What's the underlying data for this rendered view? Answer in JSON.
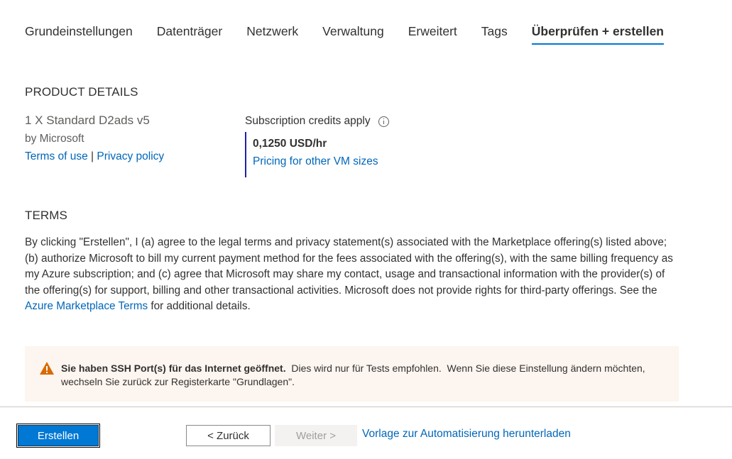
{
  "tabs": [
    {
      "label": "Grundeinstellungen"
    },
    {
      "label": "Datenträger"
    },
    {
      "label": "Netzwerk"
    },
    {
      "label": "Verwaltung"
    },
    {
      "label": "Erweitert"
    },
    {
      "label": "Tags"
    },
    {
      "label": "Überprüfen + erstellen",
      "active": true
    }
  ],
  "product_details": {
    "title": "PRODUCT DETAILS",
    "name": "1 X Standard D2ads v5",
    "by": "by Microsoft",
    "terms_link": "Terms of use",
    "separator": "|",
    "privacy_link": "Privacy policy",
    "subscription_label": "Subscription credits apply",
    "info_icon": "info-icon",
    "price": "0,1250 USD/hr",
    "pricing_link": "Pricing for other VM sizes"
  },
  "terms": {
    "title": "TERMS",
    "text_before": "By clicking \"Erstellen\", I (a) agree to the legal terms and privacy statement(s) associated with the Marketplace offering(s) listed above; (b) authorize Microsoft to bill my current payment method for the fees associated with the offering(s), with the same billing frequency as my Azure subscription; and (c) agree that Microsoft may share my contact, usage and transactional information with the provider(s) of the offering(s) for support, billing and other transactional activities. Microsoft does not provide rights for third-party offerings. See the ",
    "link": "Azure Marketplace Terms",
    "text_after": " for additional details."
  },
  "warning": {
    "icon": "warning-icon",
    "bold": "Sie haben SSH Port(s) für das Internet geöffnet.",
    "text": "  Dies wird nur für Tests empfohlen.  Wenn Sie diese Einstellung ändern möchten, wechseln Sie zurück zur Registerkarte \"Grundlagen\"."
  },
  "footer": {
    "create": "Erstellen",
    "back": "< Zurück",
    "next": "Weiter >",
    "download": "Vorlage zur Automatisierung herunterladen"
  },
  "colors": {
    "accent": "#0078d4",
    "link": "#0066b8",
    "warning_bg": "#fdf5ef",
    "warning_icon": "#d86a00"
  }
}
